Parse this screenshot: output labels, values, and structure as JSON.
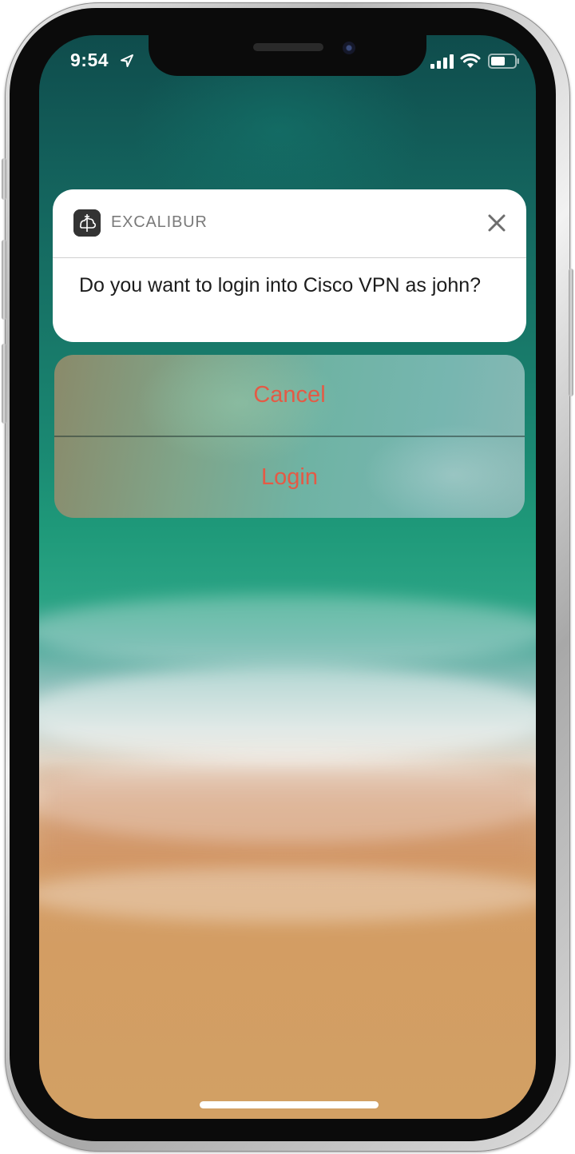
{
  "status_bar": {
    "time": "9:54"
  },
  "notification": {
    "app_name": "EXCALIBUR",
    "message": "Do you want to login into Cisco VPN as john?"
  },
  "actions": {
    "cancel_label": "Cancel",
    "login_label": "Login"
  },
  "icons": {
    "location": "location-arrow-icon",
    "signal": "cellular-signal-icon",
    "wifi": "wifi-icon",
    "battery": "battery-icon",
    "app": "excalibur-app-icon",
    "close": "close-icon"
  },
  "colors": {
    "action_text": "#e45a45",
    "notification_bg": "#ffffff",
    "app_name_text": "#7a7a7a"
  }
}
